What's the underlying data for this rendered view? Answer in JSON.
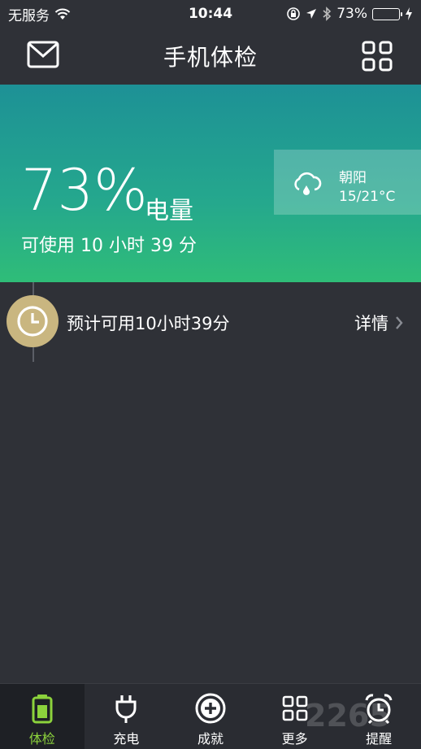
{
  "status_bar": {
    "carrier": "无服务",
    "time": "10:44",
    "battery_percent": "73%",
    "battery_level": 0.73,
    "icons": [
      "wifi-icon",
      "rotation-lock-icon",
      "location-icon",
      "bluetooth-icon",
      "battery-icon",
      "charging-icon"
    ]
  },
  "header": {
    "title": "手机体检",
    "left_icon": "mail-icon",
    "right_icon": "grid-icon"
  },
  "hero": {
    "battery_value": "73%",
    "battery_label": "电量",
    "remaining": "可使用 10 小时 39 分",
    "weather": {
      "city": "朝阳",
      "temperature": "15/21°C",
      "icon": "cloud-rain-icon"
    }
  },
  "main": {
    "estimate_text": "预计可用10小时39分",
    "detail_label": "详情",
    "clock_icon": "clock-icon"
  },
  "tabs": [
    {
      "label": "体检",
      "icon": "battery-icon",
      "active": true
    },
    {
      "label": "充电",
      "icon": "plug-icon",
      "active": false
    },
    {
      "label": "成就",
      "icon": "plus-circle-icon",
      "active": false
    },
    {
      "label": "更多",
      "icon": "grid-icon",
      "active": false
    },
    {
      "label": "提醒",
      "icon": "alarm-clock-icon",
      "active": false
    }
  ],
  "watermark": "2265",
  "colors": {
    "background": "#2f3137",
    "hero_top": "#1d9196",
    "hero_bottom": "#2fbd78",
    "accent_green": "#8cd23c",
    "clock_gold": "#c9b680"
  }
}
